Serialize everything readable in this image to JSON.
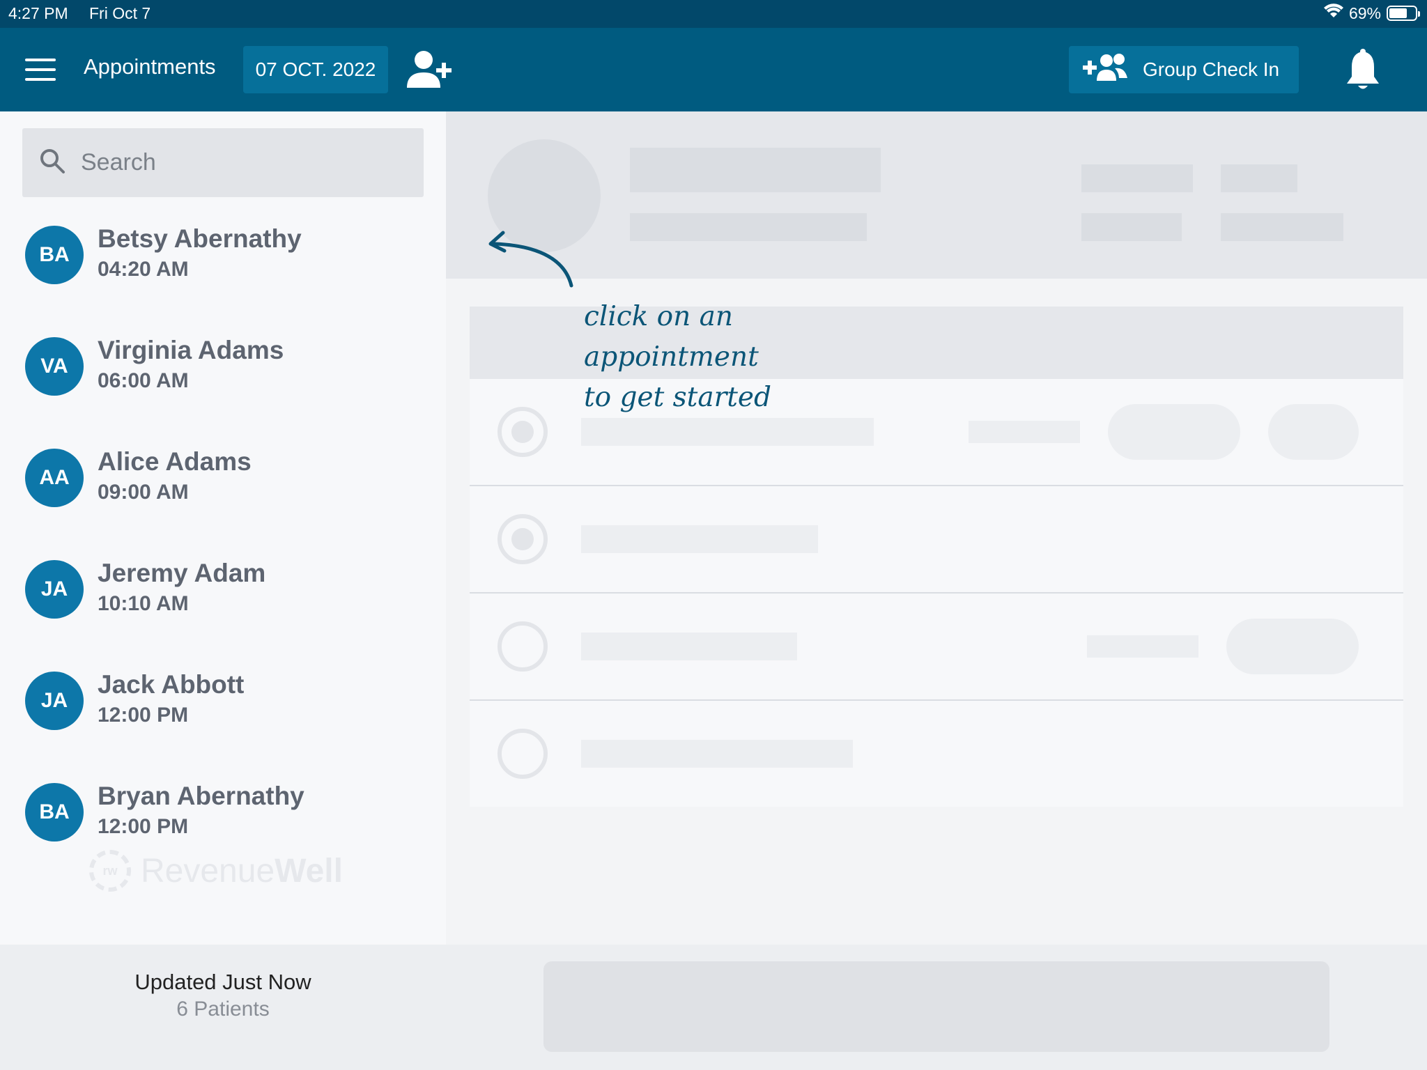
{
  "status_bar": {
    "time": "4:27 PM",
    "date": "Fri Oct 7",
    "battery": "69%",
    "battery_level": 0.69
  },
  "nav": {
    "title": "Appointments",
    "date": "07 OCT. 2022",
    "group_check_in": "Group Check In",
    "icons": {
      "menu": "hamburger-icon",
      "add_patient": "add-user-icon",
      "group": "group-add-icon",
      "notifications": "bell-icon"
    }
  },
  "search": {
    "placeholder": "Search"
  },
  "appointments": [
    {
      "initials": "BA",
      "name": "Betsy Abernathy",
      "time": "04:20 AM"
    },
    {
      "initials": "VA",
      "name": "Virginia Adams",
      "time": "06:00 AM"
    },
    {
      "initials": "AA",
      "name": "Alice Adams",
      "time": "09:00 AM"
    },
    {
      "initials": "JA",
      "name": "Jeremy Adam",
      "time": "10:10 AM"
    },
    {
      "initials": "JA",
      "name": "Jack Abbott",
      "time": "12:00 PM"
    },
    {
      "initials": "BA",
      "name": "Bryan Abernathy",
      "time": "12:00 PM"
    }
  ],
  "watermark": {
    "logo_text": "rw",
    "brand_light": "Revenue",
    "brand_bold": "Well"
  },
  "footer": {
    "updated": "Updated Just Now",
    "count": "6 Patients"
  },
  "hint": {
    "line1": "click on an",
    "line2": "appointment",
    "line3": "to get started"
  },
  "colors": {
    "header": "#005b80",
    "status_bar": "#02486a",
    "avatar": "#0d77a9",
    "button": "#06709a"
  }
}
